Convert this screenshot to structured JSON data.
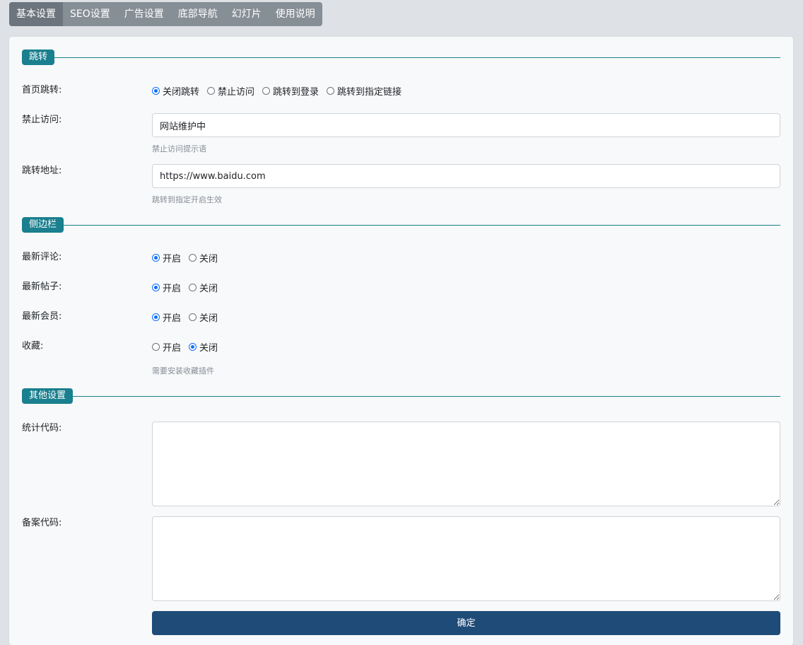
{
  "tabs": [
    "基本设置",
    "SEO设置",
    "广告设置",
    "底部导航",
    "幻灯片",
    "使用说明"
  ],
  "sections": {
    "redirect": "跳转",
    "sidebar": "侧边栏",
    "other": "其他设置"
  },
  "homepage_redirect": {
    "label": "首页跳转:",
    "options": [
      "关闭跳转",
      "禁止访问",
      "跳转到登录",
      "跳转到指定链接"
    ],
    "selected": "关闭跳转"
  },
  "forbid_access": {
    "label": "禁止访问:",
    "value": "网站维护中",
    "help": "禁止访问提示语"
  },
  "redirect_url": {
    "label": "跳转地址:",
    "value": "https://www.baidu.com",
    "help": "跳转到指定开启生效"
  },
  "sidebar_items": [
    {
      "label": "最新评论:",
      "options": [
        "开启",
        "关闭"
      ],
      "selected": "开启"
    },
    {
      "label": "最新帖子:",
      "options": [
        "开启",
        "关闭"
      ],
      "selected": "开启"
    },
    {
      "label": "最新会员:",
      "options": [
        "开启",
        "关闭"
      ],
      "selected": "开启"
    },
    {
      "label": "收藏:",
      "options": [
        "开启",
        "关闭"
      ],
      "selected": "关闭",
      "help": "需要安装收藏插件"
    }
  ],
  "stats_code": {
    "label": "统计代码:",
    "value": ""
  },
  "beian_code": {
    "label": "备案代码:",
    "value": ""
  },
  "submit_label": "确定",
  "colors": {
    "accent": "#1a7f8e",
    "button": "#1f4b78",
    "radio_checked": "#0d6efd"
  }
}
